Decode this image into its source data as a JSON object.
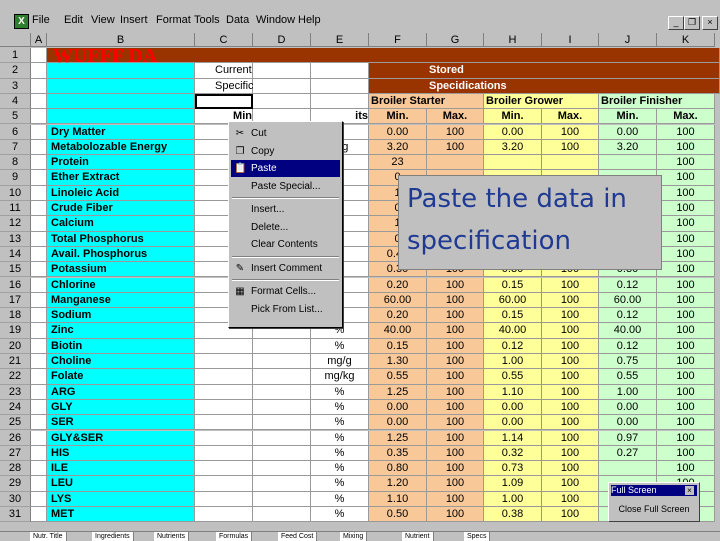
{
  "menu": {
    "excel_icon": "excel-icon",
    "items": [
      "File",
      "Edit",
      "View",
      "Insert",
      "Format",
      "Tools",
      "Data",
      "Window",
      "Help"
    ],
    "minimize": "_",
    "restore": "❐",
    "close": "×"
  },
  "columns": [
    "A",
    "B",
    "C",
    "D",
    "E",
    "F",
    "G",
    "H",
    "I",
    "J",
    "K"
  ],
  "title": "WUFFF DA",
  "current_spec": {
    "line1": "Current",
    "line2": "Specification",
    "min_header": "Min"
  },
  "stored_spec": {
    "line1": "Stored",
    "line2": "Specidications"
  },
  "units_header": "its",
  "groups": [
    "Broiler Starter",
    "Broiler Grower",
    "Broiler Finisher"
  ],
  "minmax": [
    "Min.",
    "Max.",
    "Min.",
    "Max.",
    "Min.",
    "Max."
  ],
  "row_numbers": [
    "1",
    "2",
    "3",
    "4",
    "5",
    "6",
    "7",
    "8",
    "9",
    "10",
    "11",
    "12",
    "13",
    "14",
    "15",
    "16",
    "17",
    "18",
    "19",
    "20",
    "21",
    "22",
    "23",
    "24",
    "25",
    "26",
    "27",
    "28",
    "29",
    "30",
    "31"
  ],
  "rows": [
    {
      "name": "Dry Matter",
      "unit": "",
      "v": [
        "0.00",
        "100",
        "0.00",
        "100",
        "0.00",
        "100"
      ]
    },
    {
      "name": "Metabolozable Energy",
      "unit": "al/g",
      "v": [
        "3.20",
        "100",
        "3.20",
        "100",
        "3.20",
        "100"
      ]
    },
    {
      "name": "Protein",
      "unit": "",
      "v": [
        "23",
        "",
        "",
        "",
        "",
        "100"
      ]
    },
    {
      "name": "Ether Extract",
      "unit": "",
      "v": [
        "0",
        "",
        "",
        "",
        "",
        "100"
      ]
    },
    {
      "name": "Linoleic Acid",
      "unit": "",
      "v": [
        "1",
        "",
        "",
        "",
        "",
        "100"
      ]
    },
    {
      "name": "Crude Fiber",
      "unit": "",
      "v": [
        "0",
        "",
        "",
        "",
        "",
        "100"
      ]
    },
    {
      "name": "Calcium",
      "unit": "",
      "v": [
        "1",
        "",
        "",
        "",
        "",
        "100"
      ]
    },
    {
      "name": "Total Phosphorus",
      "unit": "",
      "v": [
        "0",
        "",
        "",
        "",
        "",
        "100"
      ]
    },
    {
      "name": "Avail. Phosphorus",
      "unit": "",
      "v": [
        "0.45",
        "100",
        "0.35",
        "100",
        "0.30",
        "100"
      ]
    },
    {
      "name": "Potassium",
      "unit": "",
      "v": [
        "0.30",
        "100",
        "0.30",
        "100",
        "0.30",
        "100"
      ]
    },
    {
      "name": "Chlorine",
      "unit": "",
      "v": [
        "0.20",
        "100",
        "0.15",
        "100",
        "0.12",
        "100"
      ]
    },
    {
      "name": "Manganese",
      "unit": "",
      "v": [
        "60.00",
        "100",
        "60.00",
        "100",
        "60.00",
        "100"
      ]
    },
    {
      "name": "Sodium",
      "unit": "%",
      "v": [
        "0.20",
        "100",
        "0.15",
        "100",
        "0.12",
        "100"
      ]
    },
    {
      "name": "Zinc",
      "unit": "%",
      "v": [
        "40.00",
        "100",
        "40.00",
        "100",
        "40.00",
        "100"
      ]
    },
    {
      "name": "Biotin",
      "unit": "%",
      "v": [
        "0.15",
        "100",
        "0.12",
        "100",
        "0.12",
        "100"
      ]
    },
    {
      "name": "Choline",
      "unit": "mg/g",
      "v": [
        "1.30",
        "100",
        "1.00",
        "100",
        "0.75",
        "100"
      ]
    },
    {
      "name": "Folate",
      "unit": "mg/kg",
      "v": [
        "0.55",
        "100",
        "0.55",
        "100",
        "0.55",
        "100"
      ]
    },
    {
      "name": "ARG",
      "unit": "%",
      "v": [
        "1.25",
        "100",
        "1.10",
        "100",
        "1.00",
        "100"
      ]
    },
    {
      "name": "GLY",
      "unit": "%",
      "v": [
        "0.00",
        "100",
        "0.00",
        "100",
        "0.00",
        "100"
      ]
    },
    {
      "name": "SER",
      "unit": "%",
      "v": [
        "0.00",
        "100",
        "0.00",
        "100",
        "0.00",
        "100"
      ]
    },
    {
      "name": "GLY&SER",
      "unit": "%",
      "v": [
        "1.25",
        "100",
        "1.14",
        "100",
        "0.97",
        "100"
      ]
    },
    {
      "name": "HIS",
      "unit": "%",
      "v": [
        "0.35",
        "100",
        "0.32",
        "100",
        "0.27",
        "100"
      ]
    },
    {
      "name": "ILE",
      "unit": "%",
      "v": [
        "0.80",
        "100",
        "0.73",
        "100",
        "",
        "100"
      ]
    },
    {
      "name": "LEU",
      "unit": "%",
      "v": [
        "1.20",
        "100",
        "1.09",
        "100",
        "",
        "100"
      ]
    },
    {
      "name": "LYS",
      "unit": "%",
      "v": [
        "1.10",
        "100",
        "1.00",
        "100",
        "",
        "100"
      ]
    },
    {
      "name": "MET",
      "unit": "%",
      "v": [
        "0.50",
        "100",
        "0.38",
        "100",
        "0.32",
        "100"
      ]
    }
  ],
  "context_menu": [
    {
      "label": "Cut",
      "icon": "scissors-icon",
      "glyph": "✂"
    },
    {
      "label": "Copy",
      "icon": "copy-icon",
      "glyph": "❐"
    },
    {
      "label": "Paste",
      "icon": "paste-icon",
      "glyph": "📋",
      "highlight": true
    },
    {
      "label": "Paste Special...",
      "icon": "",
      "glyph": ""
    },
    {
      "label": "Insert...",
      "icon": "",
      "glyph": ""
    },
    {
      "label": "Delete...",
      "icon": "",
      "glyph": ""
    },
    {
      "label": "Clear Contents",
      "icon": "",
      "glyph": ""
    },
    {
      "label": "Insert Comment",
      "icon": "comment-icon",
      "glyph": "✎"
    },
    {
      "label": "Format Cells...",
      "icon": "format-cells-icon",
      "glyph": "▦"
    },
    {
      "label": "Pick From List...",
      "icon": "",
      "glyph": ""
    }
  ],
  "callout": {
    "line1": "Paste the data in",
    "line2": "specification"
  },
  "fullscreen": {
    "title": "Full Screen",
    "button": "Close Full Screen",
    "close": "×"
  },
  "tabs": [
    "Nutr. Title",
    "Ingredients",
    "Nutrients",
    "Formulas",
    "Feed Cost",
    "Mixing",
    "Nutrient",
    "Specs"
  ]
}
